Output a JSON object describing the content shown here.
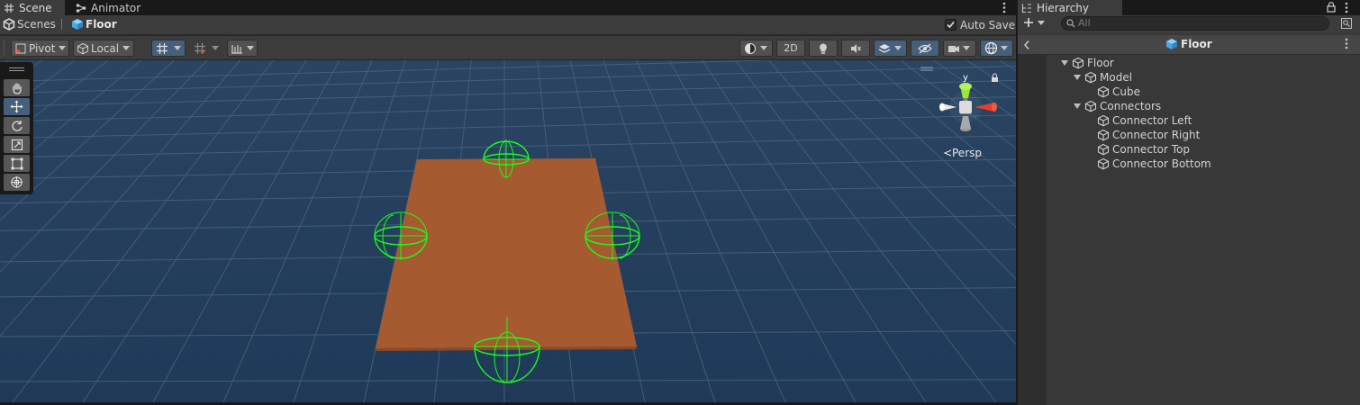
{
  "scene_window": {
    "tabs": [
      {
        "label": "Scene",
        "icon": "scene-grid-icon",
        "active": true
      },
      {
        "label": "Animator",
        "icon": "animator-icon",
        "active": false
      }
    ],
    "breadcrumb": {
      "root": "Scenes",
      "current": "Floor"
    },
    "auto_save_label": "Auto Save",
    "auto_save_checked": true,
    "toolbar": {
      "pivot_label": "Pivot",
      "local_label": "Local",
      "mode_2d_label": "2D"
    },
    "orientation_label": "Persp",
    "gizmo_axis_label": "y"
  },
  "colors": {
    "viewport_bg": "#243b57",
    "floor_fill": "#a65a2f",
    "gizmo_green": "#18ff18",
    "selection_blue": "#46607c"
  },
  "hierarchy": {
    "tab_label": "Hierarchy",
    "search_placeholder": "All",
    "header_title": "Floor",
    "items": [
      {
        "label": "Floor",
        "depth": 0,
        "expanded": true
      },
      {
        "label": "Model",
        "depth": 1,
        "expanded": true
      },
      {
        "label": "Cube",
        "depth": 2,
        "expanded": false
      },
      {
        "label": "Connectors",
        "depth": 1,
        "expanded": true
      },
      {
        "label": "Connector Left",
        "depth": 2,
        "expanded": false
      },
      {
        "label": "Connector Right",
        "depth": 2,
        "expanded": false
      },
      {
        "label": "Connector Top",
        "depth": 2,
        "expanded": false
      },
      {
        "label": "Connector Bottom",
        "depth": 2,
        "expanded": false
      }
    ]
  }
}
